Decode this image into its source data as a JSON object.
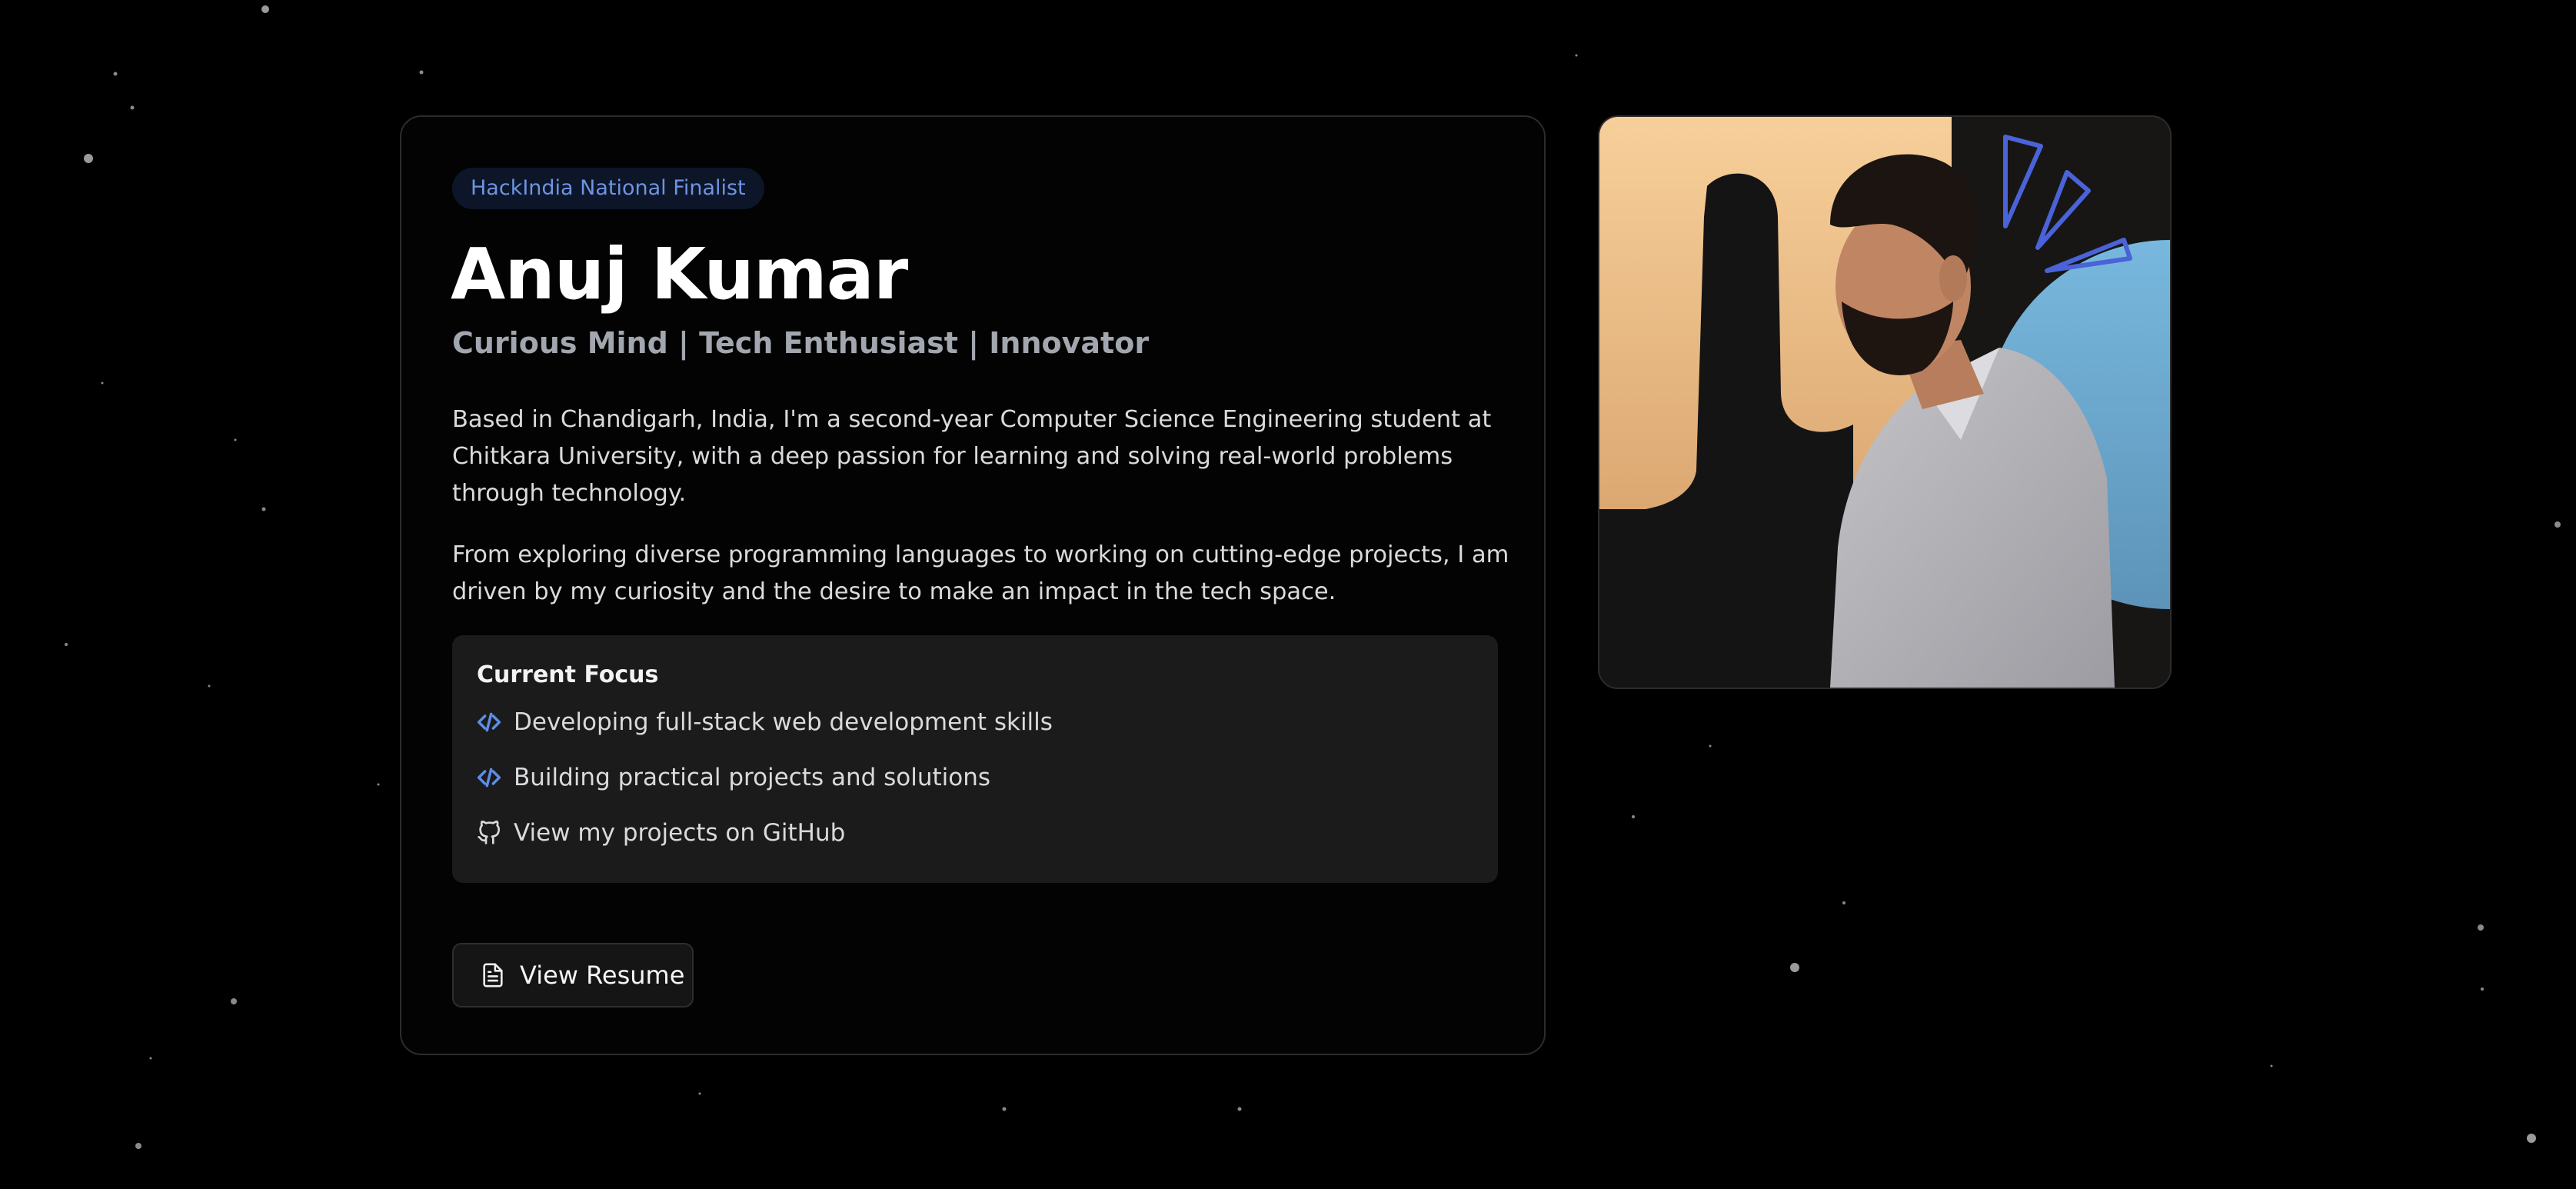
{
  "profile": {
    "badge": "HackIndia National Finalist",
    "name": "Anuj Kumar",
    "tagline": "Curious Mind | Tech Enthusiast | Innovator",
    "bio": [
      "Based in Chandigarh, India, I'm a second-year Computer Science Engineering student at Chitkara University, with a deep passion for learning and solving real-world problems through technology.",
      "From exploring diverse programming languages to working on cutting-edge projects, I am driven by my curiosity and the desire to make an impact in the tech space."
    ]
  },
  "focus": {
    "title": "Current Focus",
    "items": [
      {
        "label": "Developing full-stack web development skills",
        "icon": "code-icon"
      },
      {
        "label": "Building practical projects and solutions",
        "icon": "code-icon"
      },
      {
        "label": "View my projects on GitHub",
        "icon": "github-icon"
      }
    ]
  },
  "actions": {
    "resume_label": "View Resume",
    "resume_icon": "document-icon"
  },
  "colors": {
    "background": "#000000",
    "card_background": "#030303",
    "card_border": "#2c2c2e",
    "badge_background": "#0d1528",
    "badge_text": "#6d94e3",
    "accent": "#5c8ee6",
    "focus_box": "#1b1b1c",
    "body_text": "#dadadd",
    "muted_text": "#a2a6ae"
  }
}
